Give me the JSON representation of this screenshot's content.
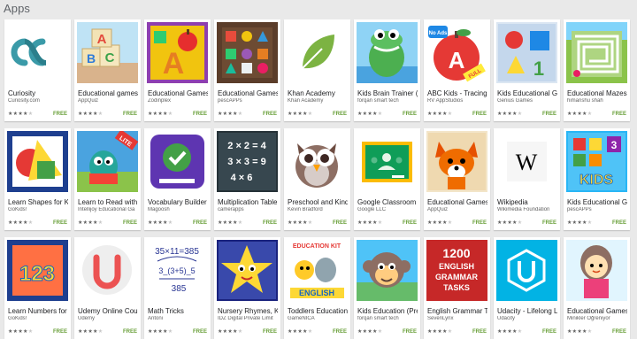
{
  "section": {
    "title": "Apps"
  },
  "colors": {
    "free": "#689f38",
    "card_bg": "#ffffff",
    "page_bg": "#e9e9e9"
  },
  "apps": [
    {
      "name": "Curiosity",
      "developer": "Curiosity.com",
      "rating": 4,
      "price": "FREE",
      "icon": "curiosity-logo-icon"
    },
    {
      "name": "Educational games",
      "developer": "AppQuiz",
      "rating": 4,
      "price": "FREE",
      "icon": "abc-blocks-icon"
    },
    {
      "name": "Educational Games",
      "developer": "Zodinplex",
      "rating": 4,
      "price": "FREE",
      "icon": "apple-letter-a-icon"
    },
    {
      "name": "Educational Games",
      "developer": "pescAPPs",
      "rating": 4,
      "price": "FREE",
      "icon": "puzzle-board-icon"
    },
    {
      "name": "Khan Academy",
      "developer": "Khan Academy",
      "rating": 4,
      "price": "FREE",
      "icon": "leaf-icon"
    },
    {
      "name": "Kids Brain Trainer (P",
      "developer": "forqan smart tech",
      "rating": 4,
      "price": "FREE",
      "icon": "crocodile-icon"
    },
    {
      "name": "ABC Kids - Tracing &",
      "developer": "RV AppStudios",
      "rating": 4,
      "price": "FREE",
      "icon": "abc-tracing-icon"
    },
    {
      "name": "Kids Educational Ga",
      "developer": "Genius Games",
      "rating": 4,
      "price": "FREE",
      "icon": "shapes-letters-icon"
    },
    {
      "name": "Educational Mazes",
      "developer": "himanshu shah",
      "rating": 4,
      "price": "FREE",
      "icon": "maze-icon"
    },
    {
      "name": "Learn Shapes for K",
      "developer": "GoKids!",
      "rating": 4,
      "price": "FREE",
      "icon": "shapes-icon"
    },
    {
      "name": "Learn to Read with",
      "developer": "Intellijoy Educational Ga",
      "rating": 4,
      "price": "FREE",
      "icon": "reading-dino-icon"
    },
    {
      "name": "Vocabulary Builder",
      "developer": "Magoosh",
      "rating": 4,
      "price": "FREE",
      "icon": "checkmark-icon"
    },
    {
      "name": "Multiplication Table",
      "developer": "camerapps",
      "rating": 4,
      "price": "FREE",
      "icon": "chalkboard-icon"
    },
    {
      "name": "Preschool and Kind",
      "developer": "Kevin Bradford",
      "rating": 4,
      "price": "FREE",
      "icon": "owl-icon"
    },
    {
      "name": "Google Classroom",
      "developer": "Google LLC",
      "rating": 4,
      "price": "FREE",
      "icon": "classroom-icon"
    },
    {
      "name": "Educational Games",
      "developer": "AppQuiz",
      "rating": 4,
      "price": "FREE",
      "icon": "fox-icon"
    },
    {
      "name": "Wikipedia",
      "developer": "Wikimedia Foundation",
      "rating": 4,
      "price": "FREE",
      "icon": "wikipedia-icon"
    },
    {
      "name": "Kids Educational Ga",
      "developer": "pescAPPs",
      "rating": 4,
      "price": "FREE",
      "icon": "kids-blocks-icon"
    },
    {
      "name": "Learn Numbers for",
      "developer": "GoKids!",
      "rating": 4,
      "price": "FREE",
      "icon": "numbers-icon"
    },
    {
      "name": "Udemy Online Cou",
      "developer": "Udemy",
      "rating": 4,
      "price": "FREE",
      "icon": "udemy-icon"
    },
    {
      "name": "Math Tricks",
      "developer": "Antoni",
      "rating": 4,
      "price": "FREE",
      "icon": "math-tricks-icon"
    },
    {
      "name": "Nursery Rhymes, K",
      "developer": "IDZ Digital Private Limit",
      "rating": 4,
      "price": "FREE",
      "icon": "star-character-icon"
    },
    {
      "name": "Toddlers Education",
      "developer": "GameNICA",
      "rating": 4,
      "price": "FREE",
      "icon": "education-kit-icon"
    },
    {
      "name": "Kids Education (Pre",
      "developer": "forqan smart tech",
      "rating": 4,
      "price": "FREE",
      "icon": "monkey-icon"
    },
    {
      "name": "English Grammar T",
      "developer": "SevenLynx",
      "rating": 4,
      "price": "FREE",
      "icon": "grammar-tasks-icon"
    },
    {
      "name": "Udacity - Lifelong L",
      "developer": "Udacity",
      "rating": 4,
      "price": "FREE",
      "icon": "udacity-icon"
    },
    {
      "name": "Educational Games",
      "developer": "Minikler Öğreniyor",
      "rating": 4,
      "price": "FREE",
      "icon": "girl-character-icon"
    }
  ],
  "icon_text": {
    "abc_blocks": [
      "A",
      "B",
      "C"
    ],
    "abc_tracing_badge": "No Ads",
    "abc_tracing_full": "FULL",
    "abc_tracing_letter": "A",
    "letter_a": "A",
    "kids_blocks": "KIDS",
    "kids_blocks_num": "3",
    "lite": "LITE",
    "mult_lines": [
      "2 × 2 = 4",
      "3 × 3 = 9",
      "4 × 6"
    ],
    "wikipedia": "W",
    "numbers": "123",
    "math_lines": [
      "35×11=385",
      "3_(3+5)_5",
      "385"
    ],
    "edu_kit_top": "EDUCATION KIT",
    "edu_kit_bottom": "ENGLISH",
    "grammar_lines": [
      "1200",
      "ENGLISH",
      "GRAMMAR",
      "TASKS"
    ],
    "shapes_digit": "1"
  }
}
